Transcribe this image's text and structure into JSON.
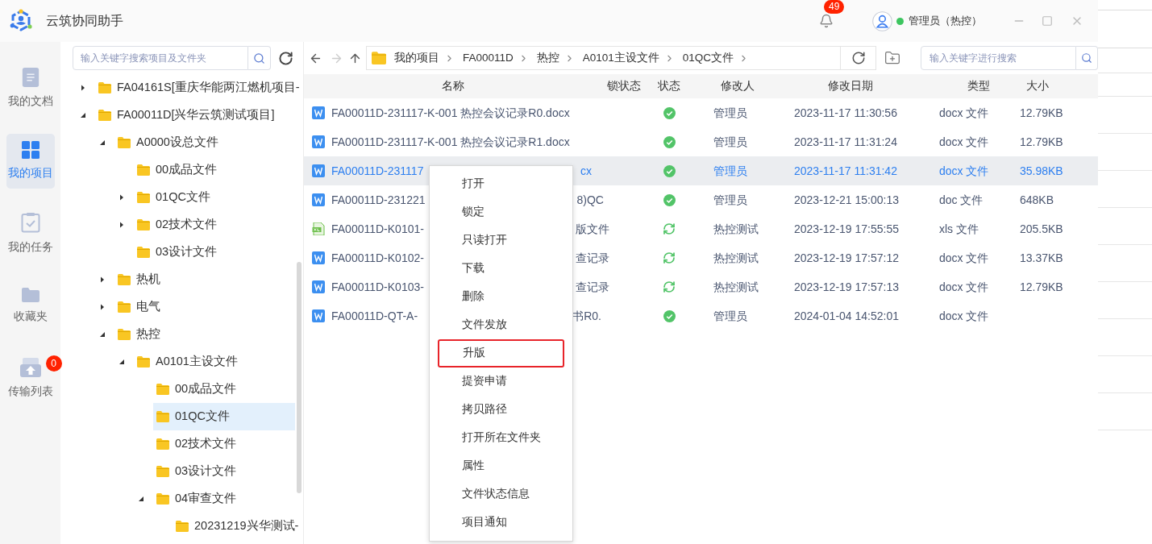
{
  "app": {
    "title": "云筑协同助手",
    "notifications": "49",
    "user": {
      "name": "管理员（热控）",
      "online": true
    }
  },
  "nav": [
    {
      "label": "我的文档",
      "selected": false
    },
    {
      "label": "我的项目",
      "selected": true
    },
    {
      "label": "我的任务",
      "selected": false
    },
    {
      "label": "收藏夹",
      "selected": false
    },
    {
      "label": "传输列表",
      "selected": false,
      "badge": "0"
    }
  ],
  "tree": {
    "placeholder": "输入关键字搜索项目及文件夹",
    "nodes": [
      {
        "label": "FA04161S[重庆华能两江燃机项目-",
        "expanded": false,
        "selected": false
      },
      {
        "label": "FA00011D[兴华云筑测试项目]",
        "expanded": true,
        "selected": false,
        "children": [
          {
            "label": "A0000设总文件",
            "expanded": true,
            "selected": false,
            "children": [
              {
                "label": "00成品文件",
                "selected": false
              },
              {
                "label": "01QC文件",
                "expanded": false,
                "selected": false
              },
              {
                "label": "02技术文件",
                "expanded": false,
                "selected": false
              },
              {
                "label": "03设计文件",
                "selected": false
              }
            ]
          },
          {
            "label": "热机",
            "expanded": false,
            "selected": false
          },
          {
            "label": "电气",
            "expanded": false,
            "selected": false
          },
          {
            "label": "热控",
            "expanded": true,
            "selected": false,
            "children": [
              {
                "label": "A0101主设文件",
                "expanded": true,
                "selected": false,
                "children": [
                  {
                    "label": "00成品文件",
                    "selected": false
                  },
                  {
                    "label": "01QC文件",
                    "selected": true
                  },
                  {
                    "label": "02技术文件",
                    "selected": false
                  },
                  {
                    "label": "03设计文件",
                    "selected": false
                  },
                  {
                    "label": "04审查文件",
                    "expanded": true,
                    "selected": false,
                    "children": [
                      {
                        "label": "20231219兴华测试-",
                        "selected": false
                      }
                    ]
                  }
                ]
              }
            ]
          }
        ]
      }
    ]
  },
  "breadcrumb": [
    "我的项目",
    "FA00011D",
    "热控",
    "A0101主设文件",
    "01QC文件"
  ],
  "file_search": {
    "placeholder": "输入关键字进行搜索"
  },
  "table": {
    "columns": [
      "名称",
      "锁状态",
      "状态",
      "修改人",
      "修改日期",
      "类型",
      "大小"
    ],
    "rows": [
      {
        "kind": "word",
        "name": "FA00011D-231117-K-001 热控会议记录R0.docx",
        "synced": true,
        "modifier": "管理员",
        "date": "2023-11-17 11:30:56",
        "type": "docx 文件",
        "size": "12.79KB",
        "selected": false
      },
      {
        "kind": "word",
        "name": "FA00011D-231117-K-001 热控会议记录R1.docx",
        "synced": true,
        "modifier": "管理员",
        "date": "2023-11-17 11:31:24",
        "type": "docx 文件",
        "size": "12.79KB",
        "selected": false
      },
      {
        "kind": "word",
        "name": "FA00011D-231117",
        "name_tail": "cx",
        "synced": true,
        "modifier": "管理员",
        "date": "2023-11-17 11:31:42",
        "type": "docx 文件",
        "size": "35.98KB",
        "selected": true
      },
      {
        "kind": "word",
        "name": "FA00011D-231221",
        "name_tail": "8)QC",
        "synced": true,
        "modifier": "管理员",
        "date": "2023-12-21 15:00:13",
        "type": "doc 文件",
        "size": "648KB",
        "selected": false
      },
      {
        "kind": "excel",
        "name": "FA00011D-K0101-",
        "name_tail": "版文件",
        "synced": false,
        "modifier": "热控测试",
        "date": "2023-12-19 17:55:55",
        "type": "xls 文件",
        "size": "205.5KB",
        "selected": false
      },
      {
        "kind": "word",
        "name": "FA00011D-K0102-",
        "name_tail": "查记录",
        "synced": false,
        "modifier": "热控测试",
        "date": "2023-12-19 17:57:12",
        "type": "docx 文件",
        "size": "13.37KB",
        "selected": false
      },
      {
        "kind": "word",
        "name": "FA00011D-K0103-",
        "name_tail": "查记录",
        "synced": false,
        "modifier": "热控测试",
        "date": "2023-12-19 17:57:13",
        "type": "docx 文件",
        "size": "12.79KB",
        "selected": false
      },
      {
        "kind": "word",
        "name": "FA00011D-QT-A-",
        "name_tail": "书R0.",
        "synced": true,
        "modifier": "管理员",
        "date": "2024-01-04 14:52:01",
        "type": "docx 文件",
        "selected": false
      }
    ]
  },
  "context_menu": [
    {
      "label": "打开",
      "highlighted": false
    },
    {
      "label": "锁定",
      "highlighted": false
    },
    {
      "label": "只读打开",
      "highlighted": false
    },
    {
      "label": "下载",
      "highlighted": false
    },
    {
      "label": "删除",
      "highlighted": false
    },
    {
      "label": "文件发放",
      "highlighted": false
    },
    {
      "label": "升版",
      "highlighted": true
    },
    {
      "label": "提资申请",
      "highlighted": false
    },
    {
      "label": "拷贝路径",
      "highlighted": false
    },
    {
      "label": "打开所在文件夹",
      "highlighted": false
    },
    {
      "label": "属性",
      "highlighted": false
    },
    {
      "label": "文件状态信息",
      "highlighted": false
    },
    {
      "label": "项目通知",
      "highlighted": false
    }
  ]
}
